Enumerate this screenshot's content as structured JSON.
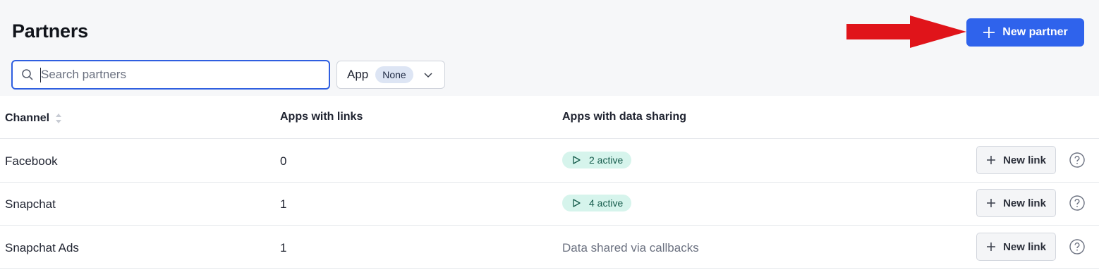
{
  "header": {
    "title": "Partners",
    "new_partner_label": "New partner"
  },
  "search": {
    "placeholder": "Search partners",
    "value": ""
  },
  "filter": {
    "label": "App",
    "value": "None"
  },
  "table": {
    "columns": [
      "Channel",
      "Apps with links",
      "Apps with data sharing"
    ],
    "rows": [
      {
        "channel": "Facebook",
        "apps_with_links": "0",
        "data_sharing": "2 active",
        "data_sharing_type": "active",
        "action_label": "New link"
      },
      {
        "channel": "Snapchat",
        "apps_with_links": "1",
        "data_sharing": "4 active",
        "data_sharing_type": "active",
        "action_label": "New link"
      },
      {
        "channel": "Snapchat Ads",
        "apps_with_links": "1",
        "data_sharing": "Data shared via callbacks",
        "data_sharing_type": "text",
        "action_label": "New link"
      }
    ]
  },
  "colors": {
    "accent": "#2f63ec",
    "annotation_arrow": "#e0141a",
    "active_pill_bg": "#d6f4ec",
    "active_pill_text": "#145a4a"
  },
  "icons": [
    "search-icon",
    "plus-icon",
    "chevron-down-icon",
    "sort-icon",
    "play-icon",
    "help-icon"
  ]
}
